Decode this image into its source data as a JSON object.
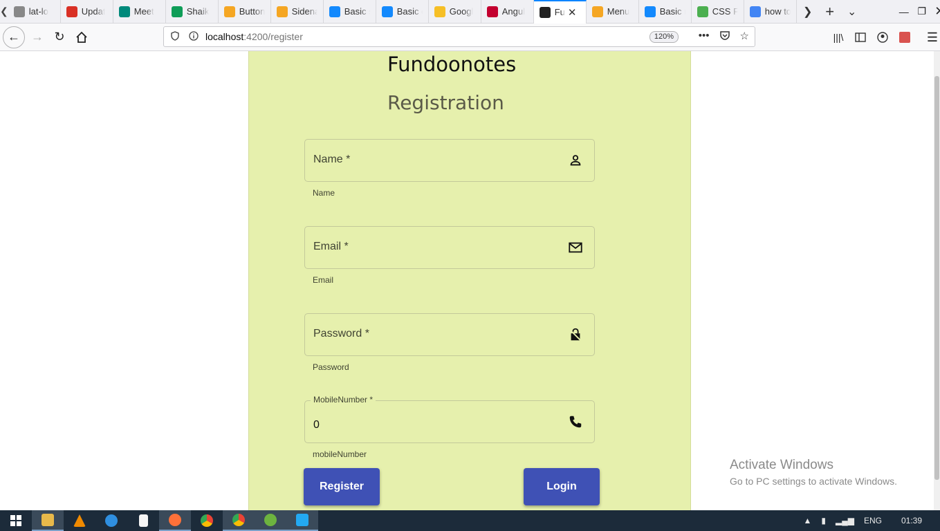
{
  "browser": {
    "tabs": [
      {
        "title": "lat-lo",
        "favicon": "generic",
        "color": "#888888"
      },
      {
        "title": "Updat",
        "favicon": "gmail",
        "color": "#d93025"
      },
      {
        "title": "Meet",
        "favicon": "meet",
        "color": "#00897b"
      },
      {
        "title": "Shaik",
        "favicon": "sheets",
        "color": "#0f9d58"
      },
      {
        "title": "Button",
        "favicon": "shield",
        "color": "#f5a623"
      },
      {
        "title": "Sidena",
        "favicon": "shield",
        "color": "#f5a623"
      },
      {
        "title": "Basic s",
        "favicon": "stackblitz",
        "color": "#1389fd"
      },
      {
        "title": "Basic c",
        "favicon": "stackblitz",
        "color": "#1389fd"
      },
      {
        "title": "Googl",
        "favicon": "keep",
        "color": "#f6bf26"
      },
      {
        "title": "Angul",
        "favicon": "angular",
        "color": "#c3002f"
      },
      {
        "title": "Fu",
        "favicon": "angular-dark",
        "color": "#222222",
        "active": true
      },
      {
        "title": "Menu",
        "favicon": "shield",
        "color": "#f5a623"
      },
      {
        "title": "Basic r",
        "favicon": "stackblitz",
        "color": "#1389fd"
      },
      {
        "title": "CSS Fl",
        "favicon": "w3",
        "color": "#4caf50"
      },
      {
        "title": "how to",
        "favicon": "google",
        "color": "#4285f4"
      }
    ],
    "url_host": "localhost",
    "url_path": ":4200/register",
    "zoom": "120%"
  },
  "page": {
    "app_title": "Fundoonotes",
    "page_title": "Registration",
    "fields": {
      "name": {
        "placeholder": "Name *",
        "hint": "Name",
        "icon": "person-icon"
      },
      "email": {
        "placeholder": "Email *",
        "hint": "Email",
        "icon": "mail-icon"
      },
      "password": {
        "placeholder": "Password *",
        "hint": "Password",
        "icon": "lock-icon"
      },
      "mobile": {
        "label": "MobileNumber *",
        "value": "0",
        "hint": "mobileNumber",
        "icon": "phone-icon"
      }
    },
    "buttons": {
      "register": "Register",
      "login": "Login"
    },
    "accent_color": "#3f51b5",
    "card_color": "#e6f0ad"
  },
  "watermark": {
    "line1": "Activate Windows",
    "line2": "Go to PC settings to activate Windows."
  },
  "taskbar": {
    "language": "ENG",
    "time": "01:39"
  }
}
